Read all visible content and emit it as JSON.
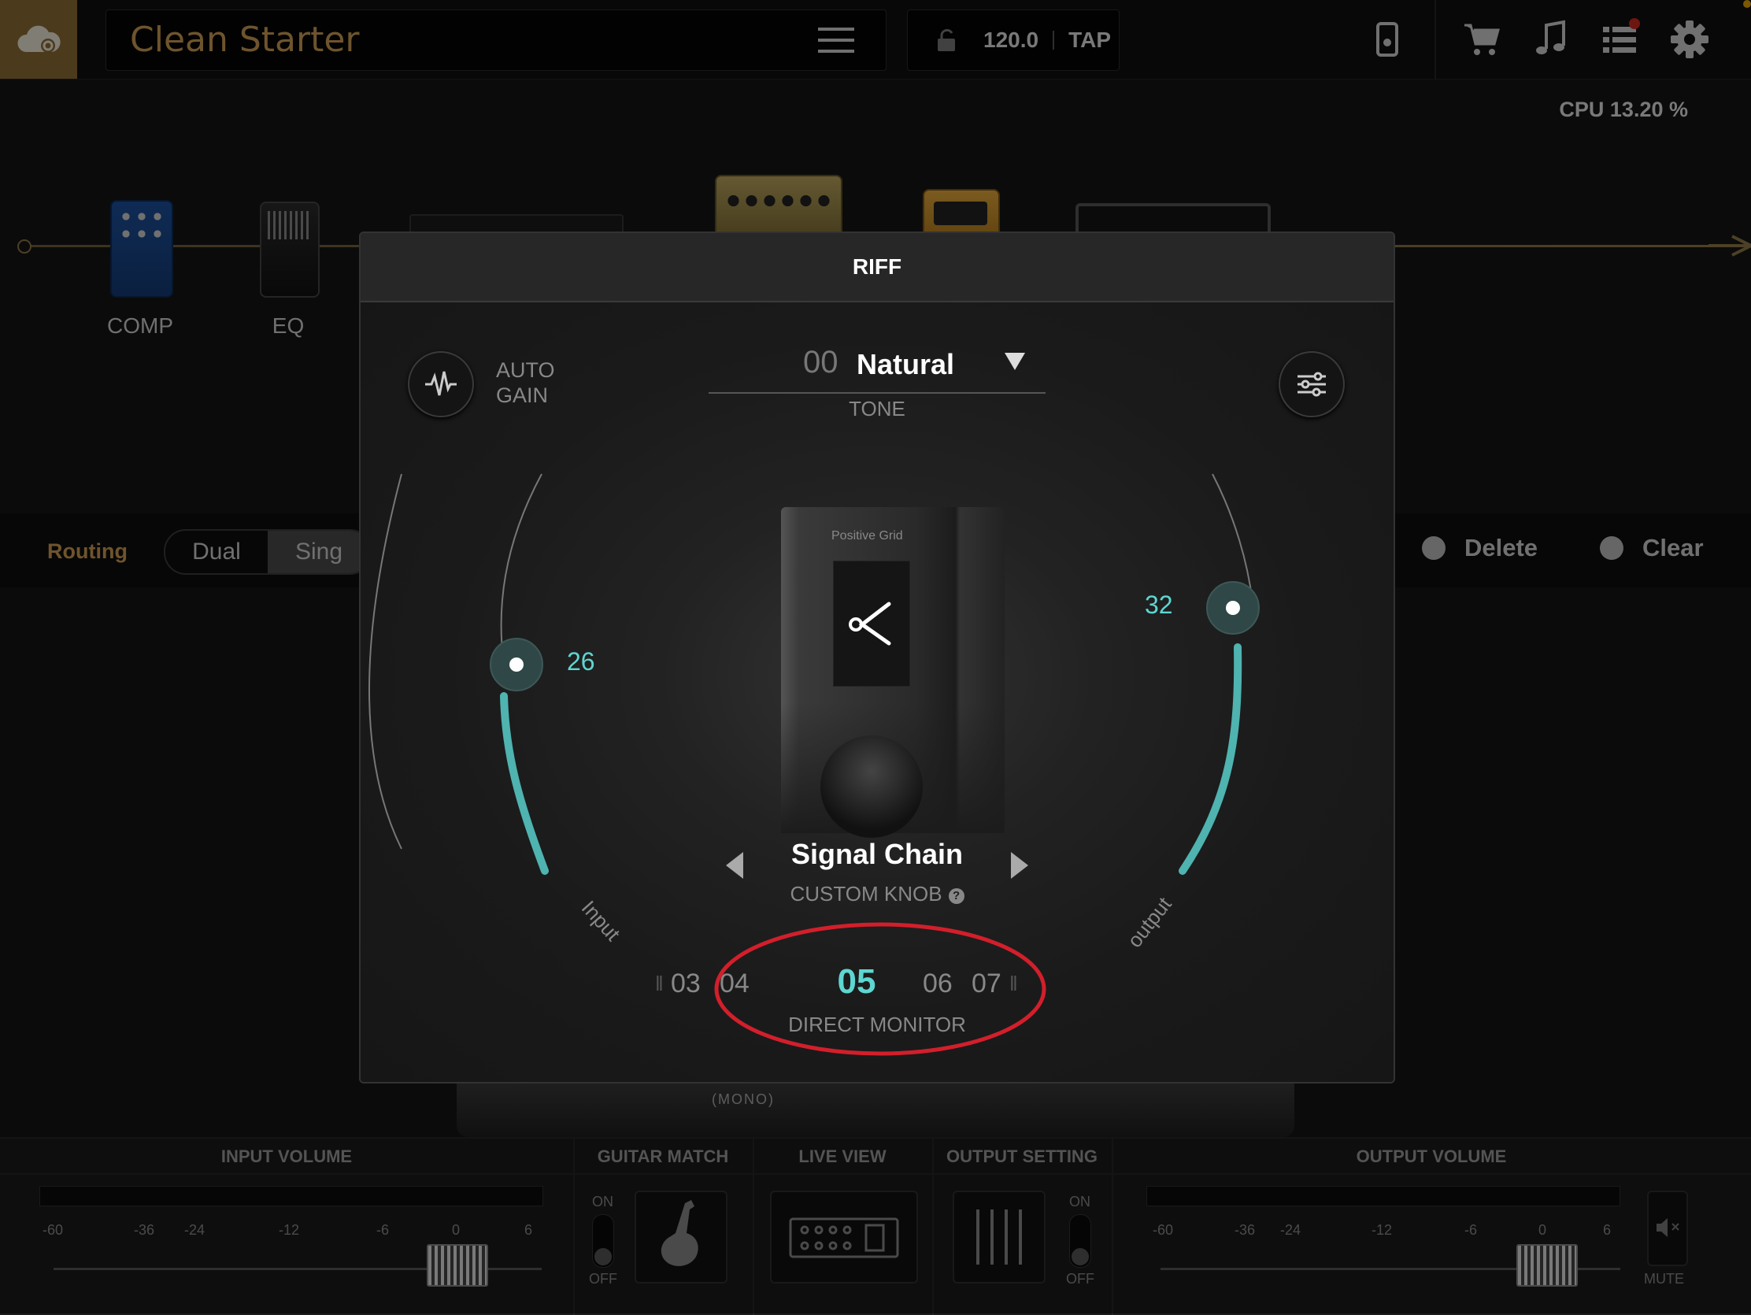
{
  "topbar": {
    "preset_name": "Clean Starter",
    "tempo": "120.0",
    "tap_label": "TAP",
    "icons": [
      "cloud-icon",
      "menu-icon",
      "lock-icon",
      "device-icon",
      "cart-icon",
      "music-note-icon",
      "list-icon",
      "gear-icon"
    ]
  },
  "status": {
    "cpu": "CPU 13.20 %"
  },
  "chain": {
    "pedals": [
      {
        "name": "compressor-pedal",
        "label": "COMP"
      },
      {
        "name": "eq-pedal",
        "label": "EQ"
      }
    ]
  },
  "routing": {
    "label": "Routing",
    "options": [
      "Dual",
      "Sing"
    ],
    "delete_label": "Delete",
    "clear_label": "Clear"
  },
  "bottom": {
    "input_volume_title": "INPUT VOLUME",
    "guitar_match_title": "GUITAR MATCH",
    "live_view_title": "LIVE VIEW",
    "output_setting_title": "OUTPUT SETTING",
    "output_volume_title": "OUTPUT VOLUME",
    "scale": [
      "-60",
      "-36",
      "-24",
      "-12",
      "-6",
      "0",
      "6"
    ],
    "on_label": "ON",
    "off_label": "OFF",
    "mute_label": "MUTE"
  },
  "riff": {
    "title": "RIFF",
    "auto_gain_line1": "AUTO",
    "auto_gain_line2": "GAIN",
    "tone_number": "00",
    "tone_name": "Natural",
    "tone_label": "TONE",
    "input_value": "26",
    "output_value": "32",
    "input_label": "Input",
    "output_label": "output",
    "device_brand": "Positive Grid",
    "custom_knob_name": "Signal Chain",
    "custom_knob_label": "CUSTOM KNOB",
    "direct_monitor": {
      "values": [
        "03",
        "04",
        "05",
        "06",
        "07"
      ],
      "current": "05",
      "label": "DIRECT MONITOR"
    }
  },
  "colors": {
    "accent": "#5ed6d1",
    "gold": "#c99a52",
    "annotation": "#d21f2b"
  }
}
